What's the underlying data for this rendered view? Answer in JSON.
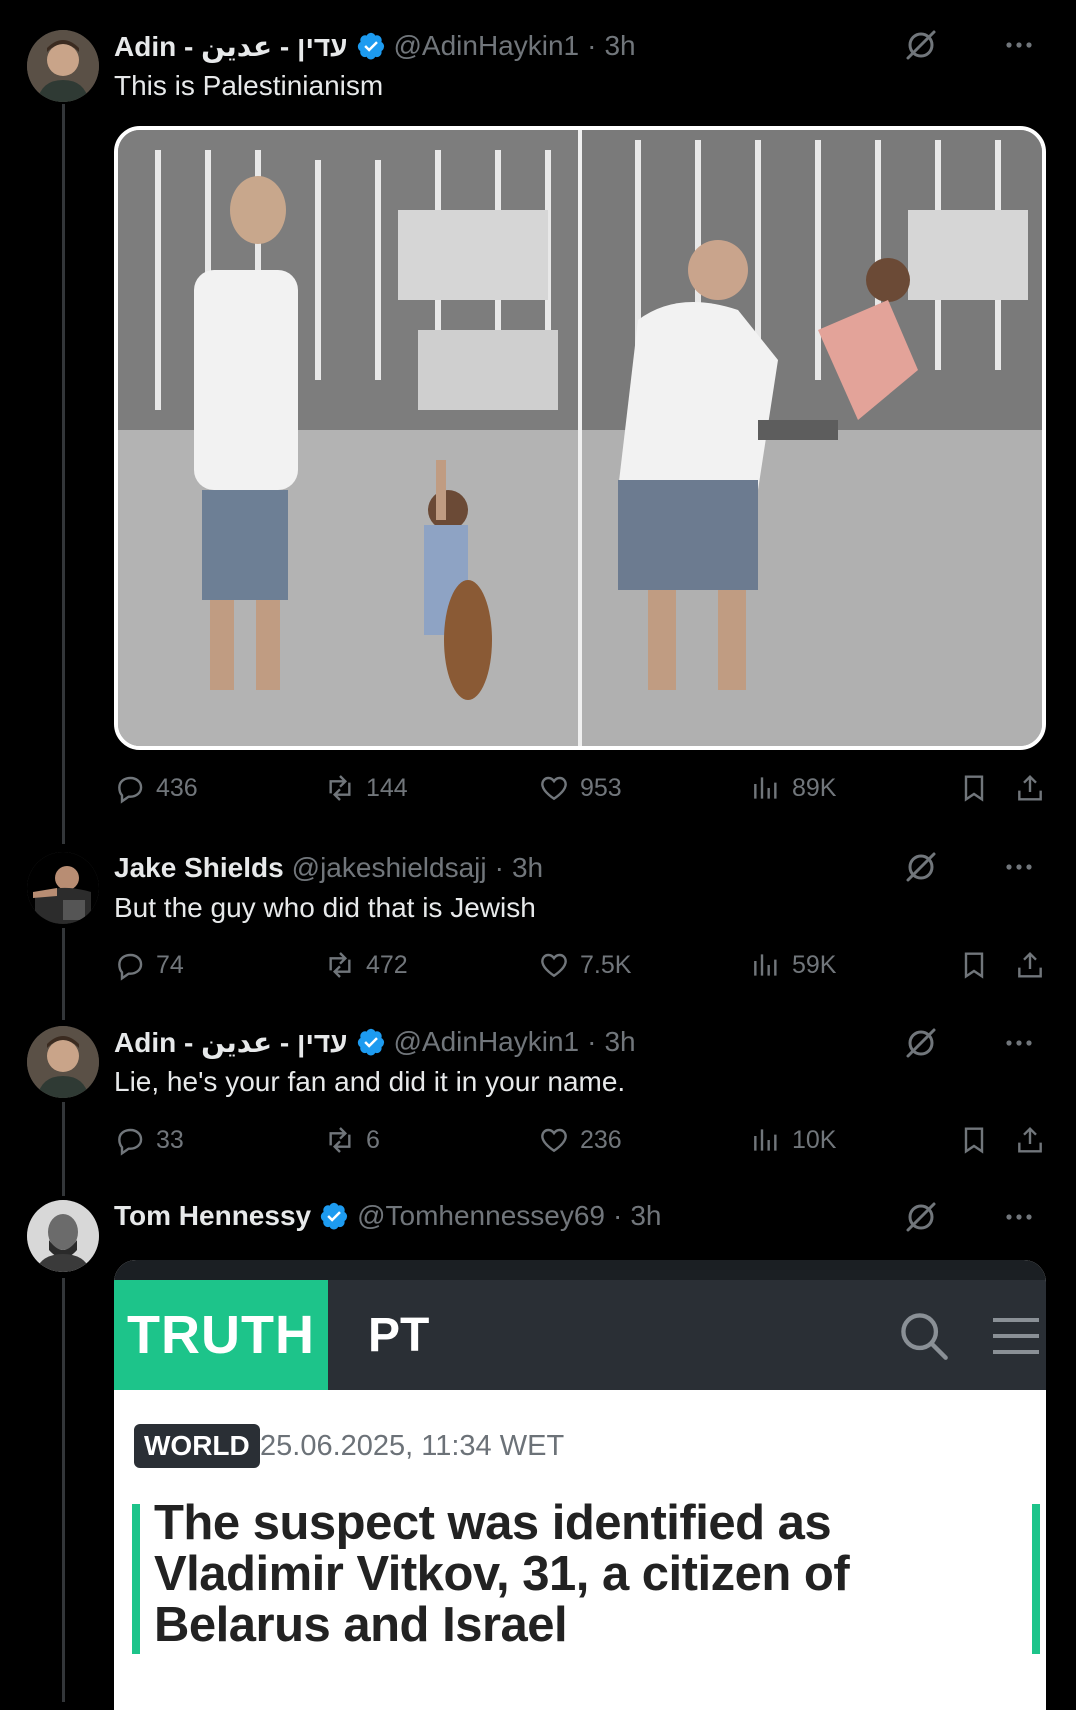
{
  "tweets": [
    {
      "name": "Adin - עדין - عدين",
      "handle": "@AdinHaykin1",
      "separator": "·",
      "time": "3h",
      "text": "This is Palestinianism",
      "verified": true,
      "stats": {
        "replies": "436",
        "reposts": "144",
        "likes": "953",
        "views": "89K"
      }
    },
    {
      "name": "Jake Shields",
      "handle": "@jakeshieldsajj",
      "separator": "·",
      "time": "3h",
      "text": "But the guy who did that is Jewish",
      "verified": false,
      "stats": {
        "replies": "74",
        "reposts": "472",
        "likes": "7.5K",
        "views": "59K"
      }
    },
    {
      "name": "Adin - עדין - عدين",
      "handle": "@AdinHaykin1",
      "separator": "·",
      "time": "3h",
      "text": "Lie, he's your fan and did it in your name.",
      "verified": true,
      "stats": {
        "replies": "33",
        "reposts": "6",
        "likes": "236",
        "views": "10K"
      }
    },
    {
      "name": "Tom Hennessy",
      "handle": "@Tomhennessey69",
      "separator": "·",
      "time": "3h",
      "verified": true
    }
  ],
  "card": {
    "logo": "TRUTH",
    "section": "PT",
    "badge": "WORLD",
    "date": "25.06.2025, 11:34 WET",
    "headline": "The suspect was identified as Vladimir Vitkov, 31, a citizen of Belarus and Israel"
  },
  "colors": {
    "background": "#000000",
    "muted": "#71767b",
    "verified": "#1d9bf0",
    "truth_green": "#1dc48a"
  },
  "icons": [
    "reply-icon",
    "repost-icon",
    "like-icon",
    "views-icon",
    "bookmark-icon",
    "share-icon",
    "grok-icon",
    "more-icon",
    "verified-badge-icon",
    "search-icon",
    "menu-icon"
  ]
}
